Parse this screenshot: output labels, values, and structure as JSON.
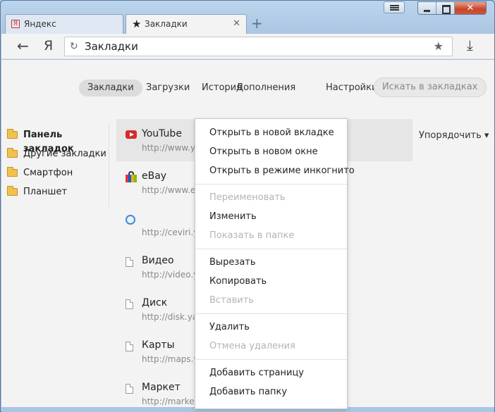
{
  "tabs": [
    {
      "label": "Яндекс",
      "icon": "yandex-favicon-icon",
      "favicon_glyph": "Я",
      "active": false
    },
    {
      "label": "Закладки",
      "icon": "star-icon",
      "active": true
    }
  ],
  "toolbar": {
    "address": "Закладки",
    "yandex_glyph": "Я"
  },
  "nav": {
    "items": [
      "Закладки",
      "Загрузки",
      "История",
      "Дополнения",
      "Настройки"
    ],
    "search_placeholder": "Искать в закладках"
  },
  "folders": [
    "Панель закладок",
    "Другие закладки",
    "Смартфон",
    "Планшет"
  ],
  "bookmarks": [
    {
      "name": "YouTube",
      "url": "http://www.yo",
      "icon": "youtube-icon"
    },
    {
      "name": "eBay",
      "url": "http://www.eb",
      "icon": "ebay-icon"
    },
    {
      "name": "",
      "url": "http://ceviri.ya",
      "icon": "ceviri-icon"
    },
    {
      "name": "Видео",
      "url": "http://video.ya",
      "icon": "page-icon"
    },
    {
      "name": "Диск",
      "url": "http://disk.ya",
      "icon": "page-icon"
    },
    {
      "name": "Карты",
      "url": "http://maps.ya",
      "icon": "page-icon"
    },
    {
      "name": "Маркет",
      "url": "http://market.",
      "icon": "page-icon"
    }
  ],
  "sort_label": "Упорядочить",
  "context_menu": {
    "groups": [
      [
        {
          "label": "Открыть в новой вкладке",
          "enabled": true
        },
        {
          "label": "Открыть в новом окне",
          "enabled": true
        },
        {
          "label": "Открыть в режиме инкогнито",
          "enabled": true
        }
      ],
      [
        {
          "label": "Переименовать",
          "enabled": false
        },
        {
          "label": "Изменить",
          "enabled": true
        },
        {
          "label": "Показать в папке",
          "enabled": false
        }
      ],
      [
        {
          "label": "Вырезать",
          "enabled": true
        },
        {
          "label": "Копировать",
          "enabled": true
        },
        {
          "label": "Вставить",
          "enabled": false
        }
      ],
      [
        {
          "label": "Удалить",
          "enabled": true
        },
        {
          "label": "Отмена удаления",
          "enabled": false
        }
      ],
      [
        {
          "label": "Добавить страницу",
          "enabled": true
        },
        {
          "label": "Добавить папку",
          "enabled": true
        }
      ]
    ]
  }
}
